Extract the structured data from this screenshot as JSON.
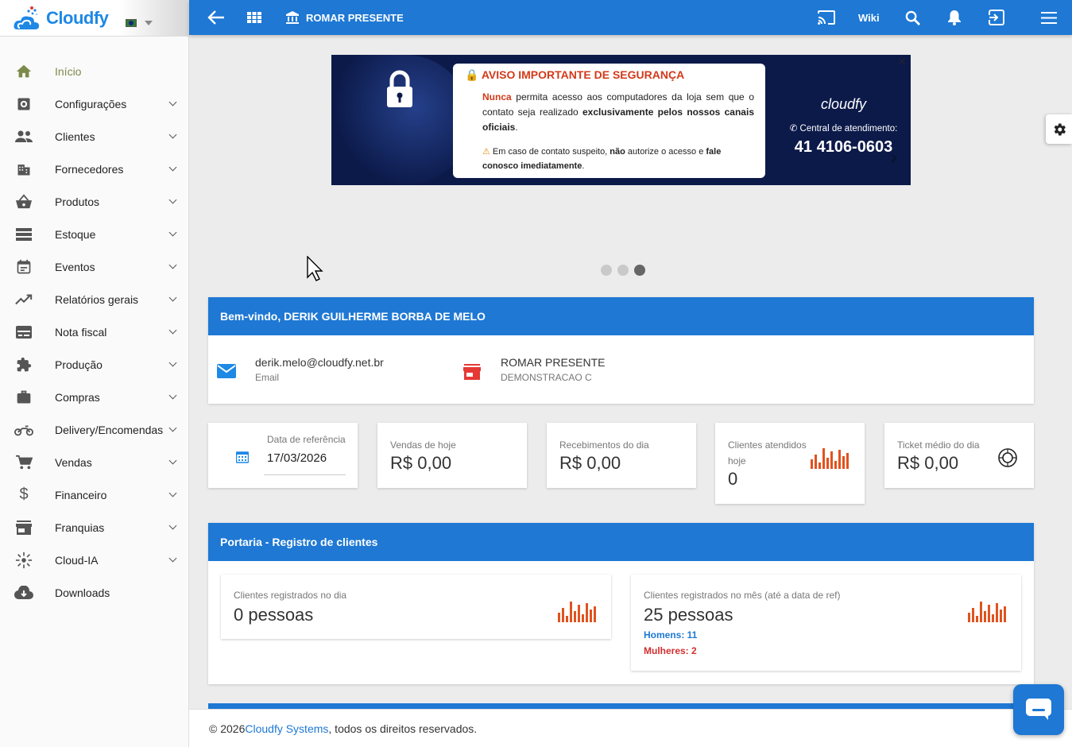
{
  "brand": {
    "name": "Cloudfy"
  },
  "sidebar": {
    "items": [
      {
        "label": "Início",
        "icon": "home-icon",
        "active": true,
        "expandable": false
      },
      {
        "label": "Configurações",
        "icon": "settings-icon",
        "expandable": true
      },
      {
        "label": "Clientes",
        "icon": "people-icon",
        "expandable": true
      },
      {
        "label": "Fornecedores",
        "icon": "building-icon",
        "expandable": true
      },
      {
        "label": "Produtos",
        "icon": "basket-icon",
        "expandable": true
      },
      {
        "label": "Estoque",
        "icon": "storage-icon",
        "expandable": true
      },
      {
        "label": "Eventos",
        "icon": "calendar-icon",
        "expandable": true
      },
      {
        "label": "Relatórios gerais",
        "icon": "trending-icon",
        "expandable": true
      },
      {
        "label": "Nota fiscal",
        "icon": "receipt-icon",
        "expandable": true
      },
      {
        "label": "Produção",
        "icon": "puzzle-icon",
        "expandable": true
      },
      {
        "label": "Compras",
        "icon": "briefcase-icon",
        "expandable": true
      },
      {
        "label": "Delivery/Encomendas",
        "icon": "motorcycle-icon",
        "expandable": true
      },
      {
        "label": "Vendas",
        "icon": "cart-icon",
        "expandable": true
      },
      {
        "label": "Financeiro",
        "icon": "dollar-icon",
        "expandable": true
      },
      {
        "label": "Franquias",
        "icon": "store-icon",
        "expandable": true
      },
      {
        "label": "Cloud-IA",
        "icon": "ai-sparkle-icon",
        "expandable": true
      },
      {
        "label": "Downloads",
        "icon": "cloud-download-icon",
        "expandable": false
      }
    ]
  },
  "topbar": {
    "store_title": "ROMAR PRESENTE",
    "wiki_label": "Wiki"
  },
  "banner": {
    "title": "AVISO IMPORTANTE DE SEGURANÇA",
    "p1_strong": "Nunca",
    "p1_a": " permita acesso aos computadores da loja sem que o contato seja realizado ",
    "p1_strong2": "exclusivamente pelos nossos canais oficiais",
    "p1_end": ".",
    "p2_a": " Em caso de contato suspeito, ",
    "p2_strong": "não",
    "p2_b": " autorize o acesso e ",
    "p2_strong2": "fale conosco imediatamente",
    "p2_end": ".",
    "logo": "cloudfy",
    "center_label": "Central de atendimento:",
    "phone": "41 4106-0603",
    "active_slide": 3,
    "slides": 3
  },
  "welcome": {
    "heading": "Bem-vindo, DERIK GUILHERME BORBA DE MELO",
    "email_value": "derik.melo@cloudfy.net.br",
    "email_label": "Email",
    "store_value": "ROMAR PRESENTE",
    "store_label": "DEMONSTRACAO C"
  },
  "kpis": {
    "ref_date_label": "Data de referência",
    "ref_date_value": "17/03/2026",
    "sales_label": "Vendas de hoje",
    "sales_value": "R$ 0,00",
    "receipts_label": "Recebimentos do dia",
    "receipts_value": "R$ 0,00",
    "clients_label_1": "Clientes atendidos",
    "clients_label_2": "hoje",
    "clients_value": "0",
    "ticket_label": "Ticket médio do dia",
    "ticket_value": "R$ 0,00"
  },
  "portaria": {
    "heading": "Portaria - Registro de clientes",
    "day_label": "Clientes registrados no dia",
    "day_value": "0 pessoas",
    "month_label": "Clientes registrados no mês (até a data de ref)",
    "month_value": "25 pessoas",
    "men": "Homens: 11",
    "women": "Mulheres: 2"
  },
  "footer": {
    "prefix": "© 2026 ",
    "link": "Cloudfy Systems",
    "suffix": ", todos os direitos reservados."
  },
  "colors": {
    "primary": "#1e78d4",
    "accent_orange": "#e0531f",
    "men": "#1e78d4",
    "women": "#d32f2f",
    "active_menu": "#7c8a4a"
  }
}
